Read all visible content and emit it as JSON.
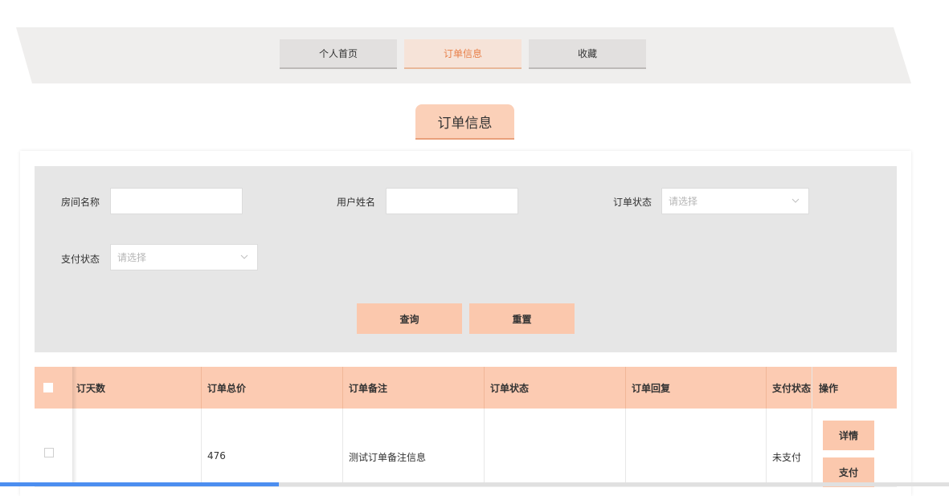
{
  "nav": {
    "items": [
      {
        "label": "个人首页",
        "active": false
      },
      {
        "label": "订单信息",
        "active": true
      },
      {
        "label": "收藏",
        "active": false
      }
    ]
  },
  "page_title": "订单信息",
  "search": {
    "room_name_label": "房间名称",
    "room_name_value": "",
    "user_name_label": "用户姓名",
    "user_name_value": "",
    "order_status_label": "订单状态",
    "order_status_placeholder": "请选择",
    "pay_status_label": "支付状态",
    "pay_status_placeholder": "请选择",
    "query_label": "查询",
    "reset_label": "重置"
  },
  "table": {
    "headers": [
      "订天数",
      "订单总价",
      "订单备注",
      "订单状态",
      "订单回复",
      "支付状态",
      "操作"
    ],
    "rows": [
      {
        "days": "",
        "total": "476",
        "remark": "测试订单备注信息",
        "status": "",
        "reply": "",
        "pay_status": "未支付",
        "actions": [
          "详情",
          "支付"
        ]
      }
    ]
  },
  "colors": {
    "accent": "#fbc8ad",
    "active_nav_text": "#e8804a",
    "panel_bg": "#e6e6e6",
    "progress": "#4c8ef0"
  }
}
